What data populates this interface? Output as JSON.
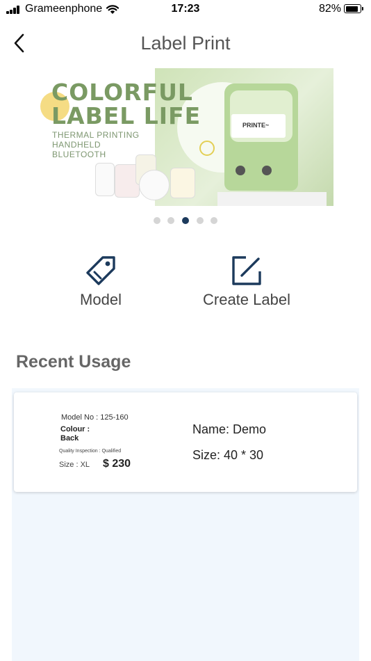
{
  "status_bar": {
    "carrier": "Grameenphone",
    "time": "17:23",
    "battery_percent": "82%",
    "battery_level": 0.82,
    "icons": [
      "signal-icon",
      "wifi-icon",
      "battery-icon"
    ]
  },
  "header": {
    "title": "Label Print",
    "back_icon": "chevron-left-icon"
  },
  "banner": {
    "headline_line1": "COLORFUL",
    "headline_line2": "LABEL LIFE",
    "sub_line1": "THERMAL PRINTING",
    "sub_line2": "HANDHELD",
    "sub_line3": "BLUETOOTH",
    "printer_paper_text": "PRINTE~",
    "slide_count": 5,
    "active_slide": 3
  },
  "actions": {
    "model_label": "Model",
    "model_icon": "tag-icon",
    "create_label": "Create Label",
    "create_icon": "edit-icon"
  },
  "recent": {
    "title": "Recent Usage",
    "card": {
      "preview": {
        "model_no": "Model No : 125-160",
        "colour_label": "Colour :",
        "colour_value": "Back",
        "quality": "Quality Inspection : Qualified",
        "size": "Size : XL",
        "price": "$ 230"
      },
      "name": "Name: Demo",
      "size": "Size: 40 * 30"
    }
  },
  "colors": {
    "accent": "#1c3a5c",
    "title_gray": "#555555",
    "banner_green": "#7a9a63",
    "recent_bg": "#f1f7fd"
  }
}
